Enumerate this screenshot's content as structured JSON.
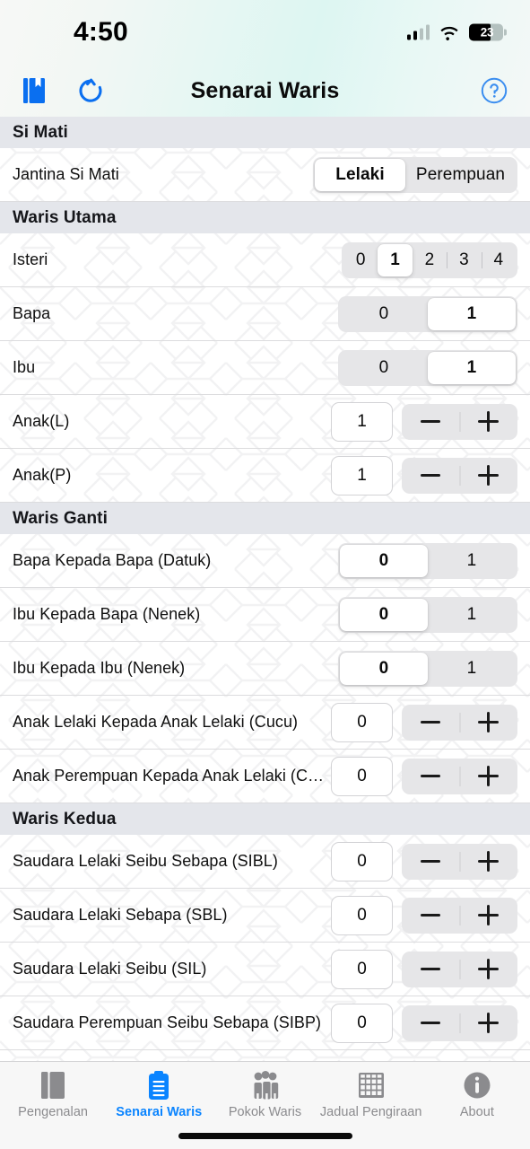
{
  "status_bar": {
    "time": "4:50",
    "cellular_icon": "cellular-bars-icon",
    "wifi_icon": "wifi-icon",
    "battery_level": "23",
    "battery_icon": "battery-icon"
  },
  "nav_bar": {
    "title": "Senarai Waris",
    "bookmark_icon": "book-bookmark-icon",
    "refresh_icon": "refresh-icon",
    "help_icon": "question-circle-icon",
    "accent_color": "#0a6ff0"
  },
  "sections": [
    {
      "title": "Si Mati",
      "rows": [
        {
          "label": "Jantina Si Mati",
          "type": "segmented",
          "options": [
            "Lelaki",
            "Perempuan"
          ],
          "selected_index": 0,
          "style": "gender"
        }
      ]
    },
    {
      "title": "Waris Utama",
      "rows": [
        {
          "label": "Isteri",
          "type": "segmented",
          "options": [
            "0",
            "1",
            "2",
            "3",
            "4"
          ],
          "selected_index": 1,
          "style": "count5"
        },
        {
          "label": "Bapa",
          "type": "segmented",
          "options": [
            "0",
            "1"
          ],
          "selected_index": 1,
          "style": "count2"
        },
        {
          "label": "Ibu",
          "type": "segmented",
          "options": [
            "0",
            "1"
          ],
          "selected_index": 1,
          "style": "count2"
        },
        {
          "label": "Anak(L)",
          "type": "stepper",
          "value": "1",
          "minus_label": "−",
          "plus_label": "+"
        },
        {
          "label": "Anak(P)",
          "type": "stepper",
          "value": "1",
          "minus_label": "−",
          "plus_label": "+"
        }
      ]
    },
    {
      "title": "Waris Ganti",
      "rows": [
        {
          "label": "Bapa Kepada Bapa  (Datuk)",
          "type": "segmented",
          "options": [
            "0",
            "1"
          ],
          "selected_index": 0,
          "style": "count2"
        },
        {
          "label": "Ibu Kepada Bapa (Nenek)",
          "type": "segmented",
          "options": [
            "0",
            "1"
          ],
          "selected_index": 0,
          "style": "count2"
        },
        {
          "label": "Ibu Kepada Ibu (Nenek)",
          "type": "segmented",
          "options": [
            "0",
            "1"
          ],
          "selected_index": 0,
          "style": "count2"
        },
        {
          "label": "Anak Lelaki Kepada Anak Lelaki (Cucu)",
          "type": "stepper",
          "value": "0",
          "minus_label": "−",
          "plus_label": "+"
        },
        {
          "label": "Anak Perempuan Kepada Anak Lelaki (Cucu)",
          "type": "stepper",
          "value": "0",
          "minus_label": "−",
          "plus_label": "+"
        }
      ]
    },
    {
      "title": "Waris Kedua",
      "rows": [
        {
          "label": "Saudara Lelaki Seibu Sebapa (SIBL)",
          "type": "stepper",
          "value": "0",
          "minus_label": "−",
          "plus_label": "+"
        },
        {
          "label": "Saudara Lelaki Sebapa (SBL)",
          "type": "stepper",
          "value": "0",
          "minus_label": "−",
          "plus_label": "+"
        },
        {
          "label": "Saudara Lelaki Seibu (SIL)",
          "type": "stepper",
          "value": "0",
          "minus_label": "−",
          "plus_label": "+"
        },
        {
          "label": "Saudara Perempuan Seibu Sebapa (SIBP)",
          "type": "stepper",
          "value": "0",
          "minus_label": "−",
          "plus_label": "+"
        }
      ]
    }
  ],
  "tab_bar": {
    "active_index": 1,
    "active_color": "#0a84ff",
    "inactive_color": "#8b8b8e",
    "tabs": [
      {
        "label": "Pengenalan",
        "icon": "book-icon"
      },
      {
        "label": "Senarai Waris",
        "icon": "clipboard-list-icon"
      },
      {
        "label": "Pokok Waris",
        "icon": "people-group-icon"
      },
      {
        "label": "Jadual Pengiraan",
        "icon": "table-grid-icon"
      },
      {
        "label": "About",
        "icon": "info-circle-icon"
      }
    ]
  }
}
